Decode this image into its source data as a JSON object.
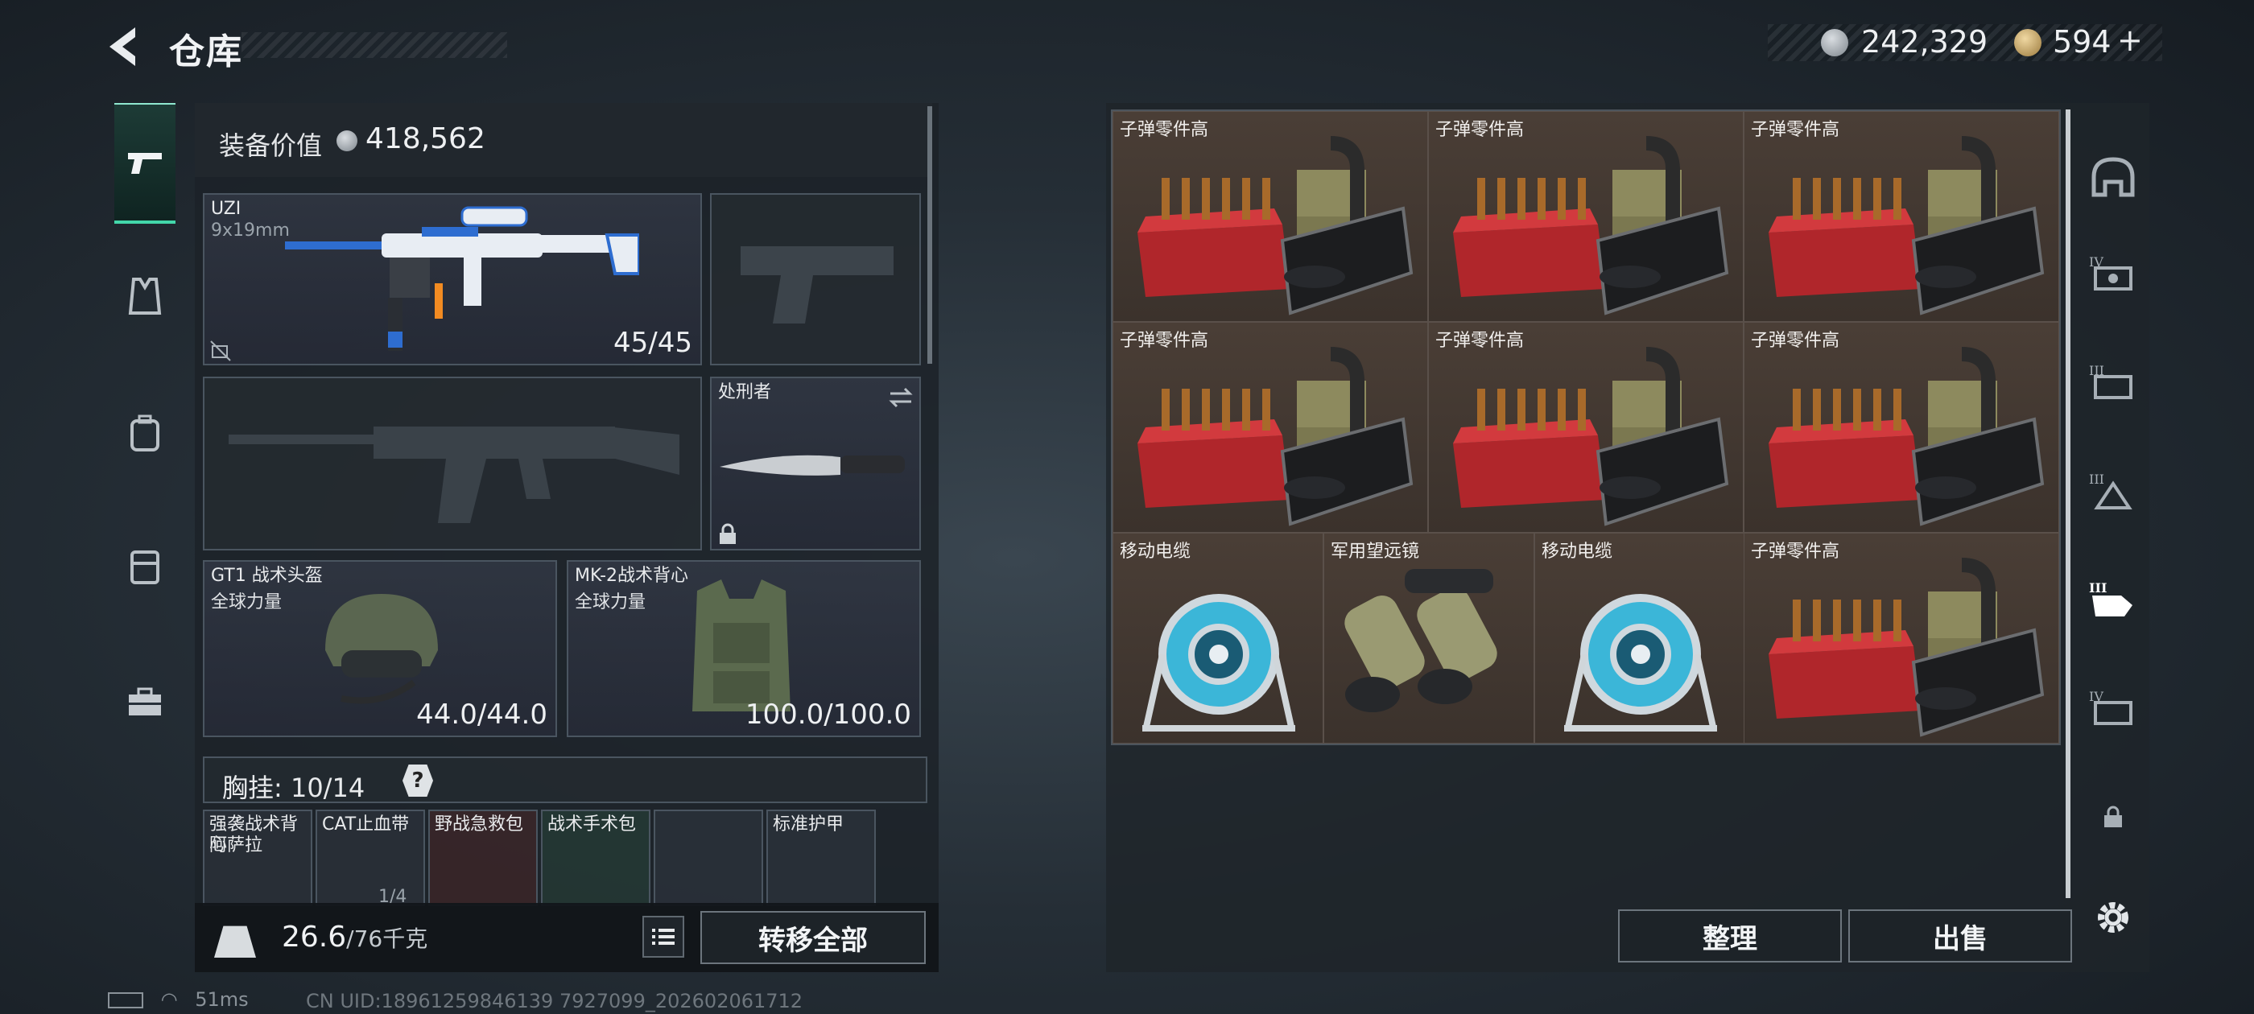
{
  "header": {
    "title": "仓库",
    "currency_primary": "242,329",
    "currency_secondary": "594",
    "add_symbol": "+"
  },
  "left_nav": {
    "items": [
      {
        "icon": "pistol-icon",
        "active": true
      },
      {
        "icon": "vest-icon",
        "active": false
      },
      {
        "icon": "backpack-icon",
        "active": false
      },
      {
        "icon": "case-icon",
        "active": false
      },
      {
        "icon": "briefcase-icon",
        "active": false
      }
    ]
  },
  "equipment": {
    "value_label": "装备价值",
    "value": "418,562",
    "primary_weapon": {
      "name": "UZI",
      "caliber": "9x19mm",
      "ammo": "45/45"
    },
    "melee": {
      "name": "处刑者"
    },
    "helmet": {
      "name": "GT1 战术头盔",
      "brand": "全球力量",
      "durability": "44.0/44.0"
    },
    "armor": {
      "name": "MK-2战术背心",
      "brand": "全球力量",
      "durability": "100.0/100.0"
    },
    "chest_rig": {
      "label": "胸挂: 10/14",
      "help": "?"
    },
    "rig_items": [
      {
        "name": "强袭战术背心",
        "sub": "阿萨拉"
      },
      {
        "name": "CAT止血带",
        "sub": "1/4"
      },
      {
        "name": "野战急救包",
        "sub": ""
      },
      {
        "name": "战术手术包",
        "sub": ""
      },
      {
        "name": "",
        "sub": ""
      },
      {
        "name": "标准护甲",
        "sub": ""
      }
    ]
  },
  "footer": {
    "weight": "26.6",
    "capacity": "/76千克",
    "transfer_all": "转移全部"
  },
  "storage": {
    "items": [
      {
        "label": "子弹零件高",
        "kind": "ammo"
      },
      {
        "label": "子弹零件高",
        "kind": "ammo"
      },
      {
        "label": "子弹零件高",
        "kind": "ammo"
      },
      {
        "label": "子弹零件高",
        "kind": "ammo"
      },
      {
        "label": "子弹零件高",
        "kind": "ammo"
      },
      {
        "label": "子弹零件高",
        "kind": "ammo"
      },
      {
        "label": "移动电缆",
        "kind": "cable"
      },
      {
        "label": "军用望远镜",
        "kind": "binoculars"
      },
      {
        "label": "移动电缆",
        "kind": "cable"
      },
      {
        "label": "子弹零件高",
        "kind": "ammo"
      }
    ],
    "sort_label": "整理",
    "sell_label": "出售"
  },
  "right_nav": {
    "items": [
      "helmet-tab-icon",
      "tier-iv-tab-icon",
      "tier-iii-tab-icon",
      "tier-iii-armor-tab-icon",
      "tier-iii-active-tab-icon",
      "tier-iv-alt-tab-icon",
      "lock-icon",
      "settings-gear-icon"
    ]
  },
  "status_bar": {
    "ping": "51ms",
    "uid": "CN UID:18961259846139 7927099_202602061712"
  },
  "colors": {
    "accent_green": "#43d7aa",
    "cell_brown": "#3b322c",
    "panel": "#1c2228"
  }
}
